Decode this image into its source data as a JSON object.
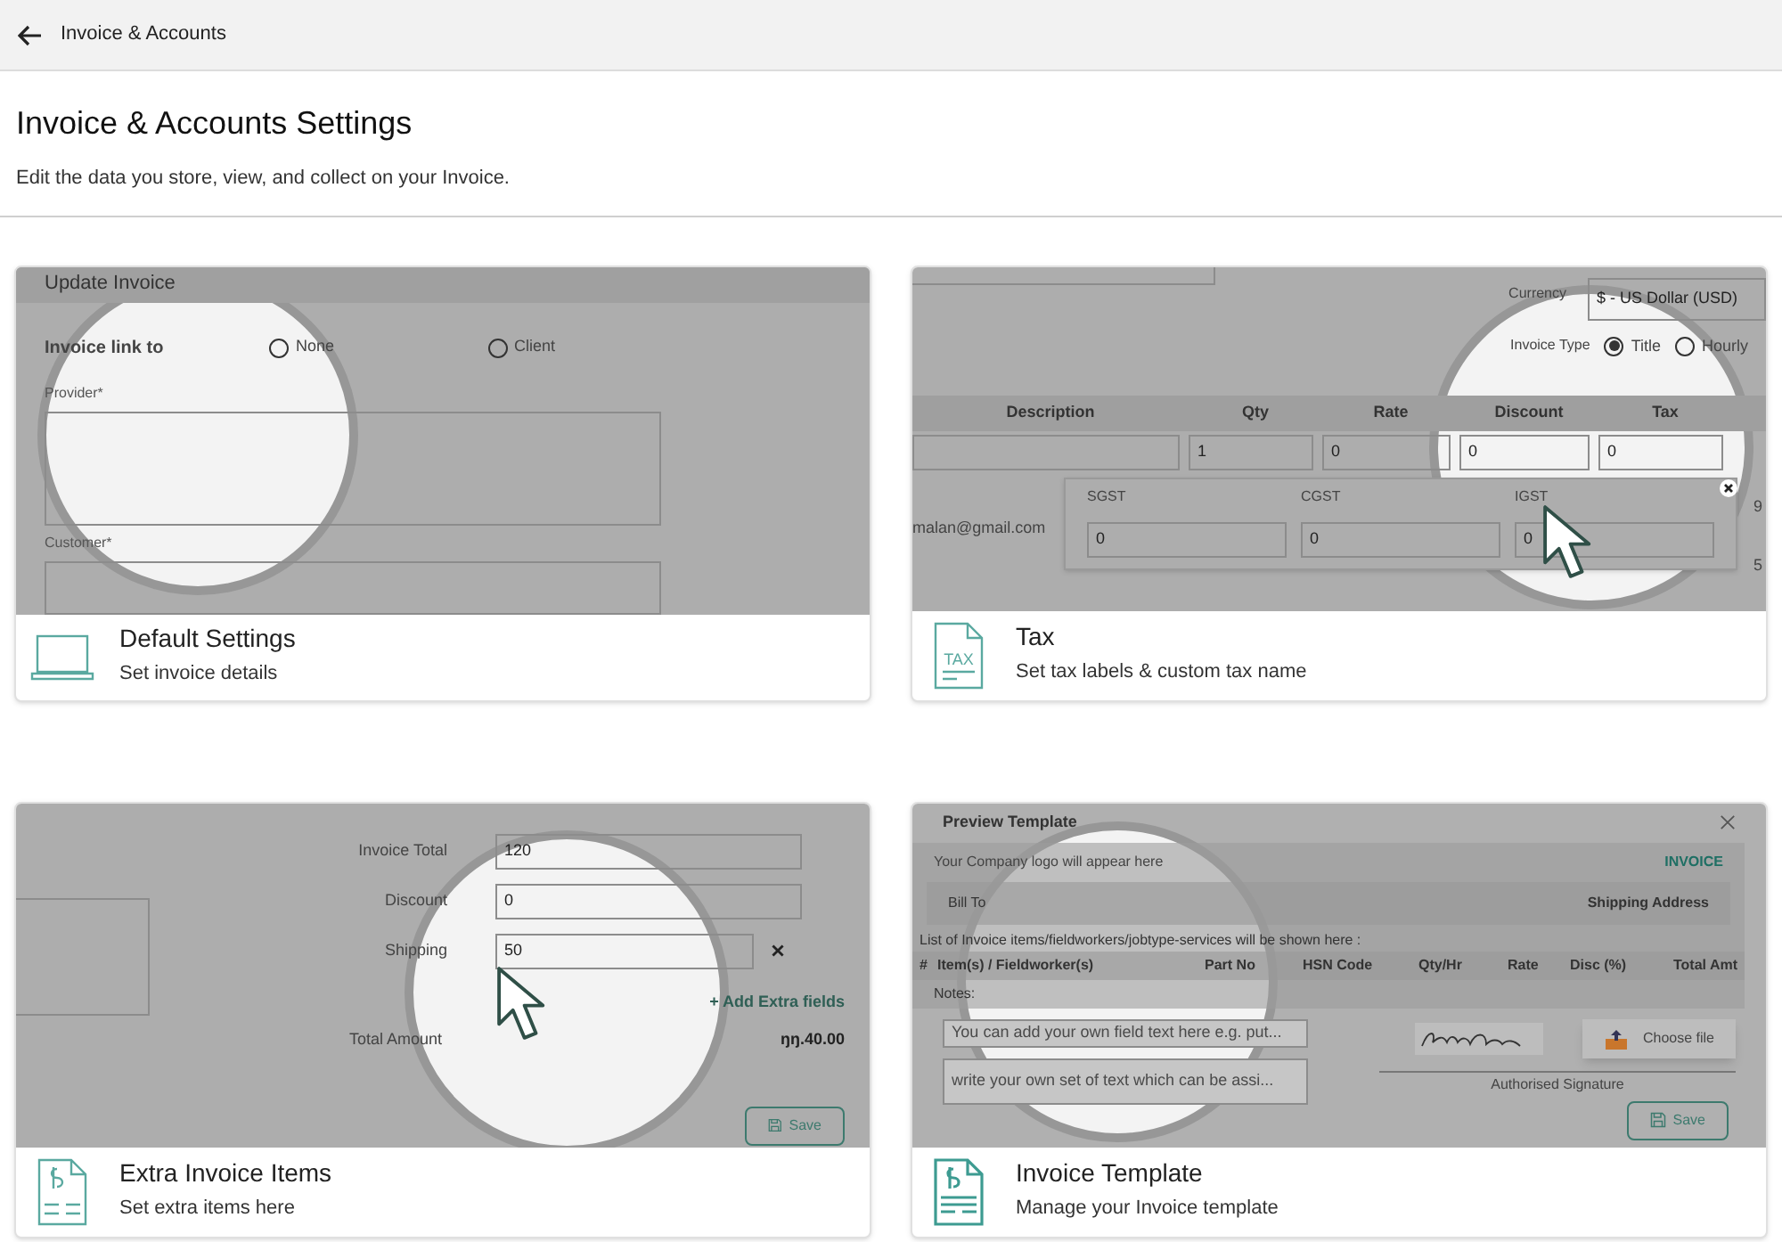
{
  "top_bar": {
    "title": "Invoice & Accounts"
  },
  "page": {
    "title": "Invoice & Accounts Settings",
    "subtitle": "Edit the data you store, view, and collect on your Invoice."
  },
  "cards": [
    {
      "kind": "default",
      "title": "Default Settings",
      "subtitle": "Set invoice details",
      "preview": {
        "heading": "Update Invoice",
        "link_label": "Invoice link to",
        "options": [
          {
            "label": "None",
            "selected": false
          },
          {
            "label": "Client",
            "selected": false
          }
        ],
        "fields": [
          "Provider*",
          "Customer*"
        ]
      }
    },
    {
      "kind": "tax",
      "title": "Tax",
      "subtitle": "Set tax labels & custom tax name",
      "icon_label": "TAX",
      "preview": {
        "currency_label": "Currency",
        "currency_value": "$ - US Dollar (USD)",
        "type_label": "Invoice Type",
        "options": [
          {
            "label": "Title",
            "selected": true
          },
          {
            "label": "Hourly",
            "selected": false
          }
        ],
        "columns": [
          "Description",
          "Qty",
          "Rate",
          "Discount",
          "Tax"
        ],
        "row": [
          "1",
          "0",
          "0",
          "0"
        ],
        "taxes": [
          {
            "label": "SGST",
            "value": "0"
          },
          {
            "label": "CGST",
            "value": "0"
          },
          {
            "label": "IGST",
            "value": "0"
          }
        ],
        "email": "malan@gmail.com",
        "edge_values": [
          "9",
          "5"
        ]
      }
    },
    {
      "kind": "extra",
      "title": "Extra Invoice Items",
      "subtitle": "Set extra items here",
      "preview": {
        "rows": [
          {
            "label": "Invoice Total",
            "value": "120",
            "removable": false
          },
          {
            "label": "Discount",
            "value": "0",
            "removable": false
          },
          {
            "label": "Shipping",
            "value": "50",
            "removable": true
          }
        ],
        "add_link": "+ Add Extra fields",
        "total_label": "Total Amount",
        "total_value": "ŋŋ.40.00",
        "save": "Save"
      }
    },
    {
      "kind": "template",
      "title": "Invoice Template",
      "subtitle": "Manage your Invoice template",
      "preview": {
        "title": "Preview Template",
        "logo_text": "Your Company logo will appear here",
        "doc_title": "INVOICE",
        "bill_to": "Bill To",
        "shipping": "Shipping Address",
        "list_note": "List of Invoice items/fieldworkers/jobtype-services will be shown here :",
        "columns": [
          "#",
          "Item(s) / Fieldworker(s)",
          "Part No",
          "HSN Code",
          "Qty/Hr",
          "Rate",
          "Disc (%)",
          "Total Amt"
        ],
        "notes_label": "Notes:",
        "placeholders": [
          "You can add your own field text here e.g. put...",
          "write your own set of text which can be assi..."
        ],
        "choose_file": "Choose file",
        "signature_label": "Authorised Signature",
        "save": "Save"
      }
    }
  ]
}
